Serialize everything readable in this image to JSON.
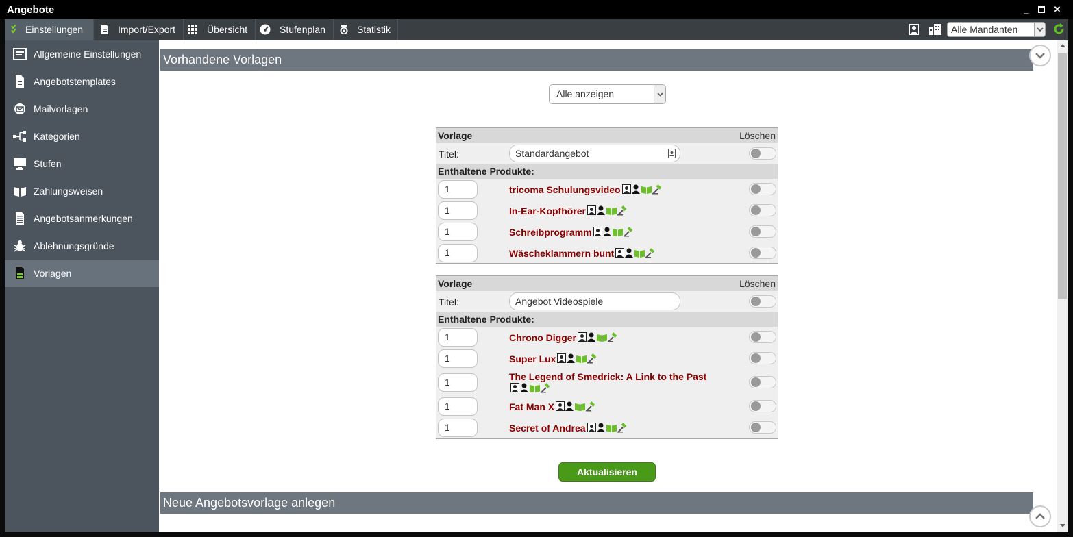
{
  "window": {
    "title": "Angebote"
  },
  "menubar": {
    "items": [
      {
        "label": "Einstellungen",
        "icon": "checklist-icon"
      },
      {
        "label": "Import/Export",
        "icon": "document-icon"
      },
      {
        "label": "Übersicht",
        "icon": "grid-icon"
      },
      {
        "label": "Stufenplan",
        "icon": "speedometer-icon"
      },
      {
        "label": "Statistik",
        "icon": "medal-icon"
      }
    ],
    "client_select": "Alle Mandanten"
  },
  "sidebar": {
    "items": [
      {
        "label": "Allgemeine Einstellungen"
      },
      {
        "label": "Angebotstemplates"
      },
      {
        "label": "Mailvorlagen"
      },
      {
        "label": "Kategorien"
      },
      {
        "label": "Stufen"
      },
      {
        "label": "Zahlungsweisen"
      },
      {
        "label": "Angebotsanmerkungen"
      },
      {
        "label": "Ablehnungsgründe"
      },
      {
        "label": "Vorlagen"
      }
    ]
  },
  "main": {
    "section1_title": "Vorhandene Vorlagen",
    "filter_select": "Alle anzeigen",
    "templates": [
      {
        "header_left": "Vorlage",
        "header_right": "Löschen",
        "title_label": "Titel:",
        "title_value": "Standardangebot",
        "products_header": "Enthaltene Produkte:",
        "products": [
          {
            "qty": "1",
            "name": "tricoma Schulungsvideo"
          },
          {
            "qty": "1",
            "name": "In-Ear-Kopfhörer"
          },
          {
            "qty": "1",
            "name": "Schreibprogramm"
          },
          {
            "qty": "1",
            "name": "Wäscheklammern bunt"
          }
        ]
      },
      {
        "header_left": "Vorlage",
        "header_right": "Löschen",
        "title_label": "Titel:",
        "title_value": "Angebot Videospiele",
        "products_header": "Enthaltene Produkte:",
        "products": [
          {
            "qty": "1",
            "name": "Chrono Digger"
          },
          {
            "qty": "1",
            "name": "Super Lux"
          },
          {
            "qty": "1",
            "name": "The Legend of Smedrick: A Link to the Past"
          },
          {
            "qty": "1",
            "name": "Fat Man X"
          },
          {
            "qty": "1",
            "name": "Secret of Andrea"
          }
        ]
      }
    ],
    "update_button": "Aktualisieren",
    "section2_title": "Neue Angebotsvorlage anlegen"
  },
  "colors": {
    "accent_green": "#4a9a1a",
    "product_red": "#8b0000",
    "sidebar_bg": "#4c555e"
  }
}
